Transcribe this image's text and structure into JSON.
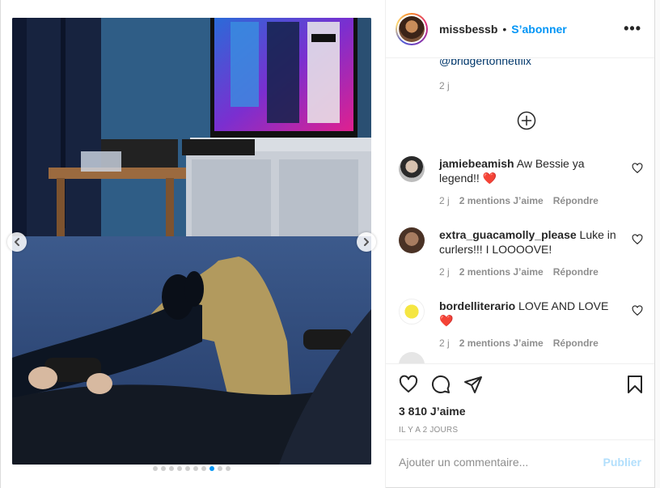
{
  "header": {
    "username": "missbessb",
    "separator": "•",
    "follow_label": "S’abonner",
    "more_icon": "more-horizontal-icon"
  },
  "caption": {
    "mention": "@bridgertonnetflix",
    "time": "2 j"
  },
  "comments": [
    {
      "username": "jamiebeamish",
      "text": "Aw Bessie ya legend!! ❤️",
      "time": "2 j",
      "likes": "2 mentions J’aime",
      "reply": "Répondre",
      "avatar_color": "#8a8a8a"
    },
    {
      "username": "extra_guacamolly_please",
      "text": "Luke in curlers!!! I LOOOOVE!",
      "time": "2 j",
      "likes": "2 mentions J’aime",
      "reply": "Répondre",
      "avatar_color": "#6b4a3a"
    },
    {
      "username": "bordelliterario",
      "text": "LOVE AND LOVE ❤️",
      "time": "2 j",
      "likes": "2 mentions J’aime",
      "reply": "Répondre",
      "avatar_color": "#f5e642"
    }
  ],
  "actions": {
    "like_icon": "heart-icon",
    "comment_icon": "comment-icon",
    "share_icon": "share-icon",
    "save_icon": "bookmark-icon",
    "likes_count": "3 810 J’aime",
    "posted": "IL Y A 2 JOURS"
  },
  "add_comment": {
    "placeholder": "Ajouter un commentaire...",
    "publish_label": "Publier"
  },
  "carousel": {
    "total_slides": 10,
    "active_index": 7
  },
  "colors": {
    "accent": "#0095f6",
    "publish_disabled": "#b2dffc",
    "text_secondary": "#8e8e8e",
    "heart_red": "#ed4956"
  }
}
